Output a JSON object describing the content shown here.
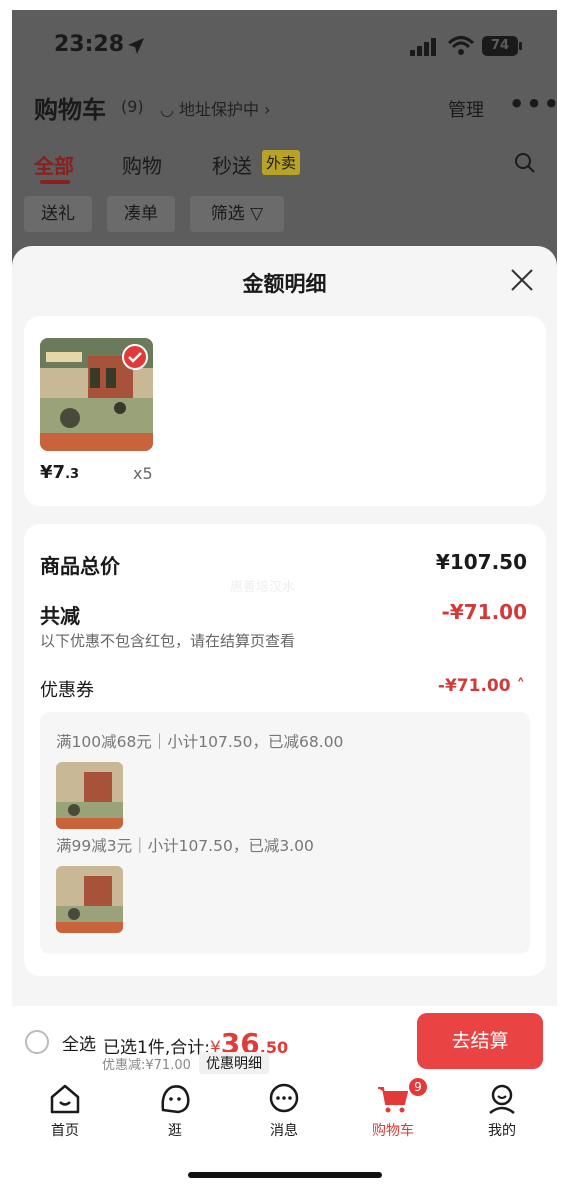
{
  "status_bar": {
    "time": "23:28",
    "battery": "74"
  },
  "header": {
    "title": "购物车",
    "count": "(9)",
    "address": "◡ 地址保护中 ›",
    "manage": "管理",
    "more": "•••"
  },
  "tabs": [
    {
      "label": "全部"
    },
    {
      "label": "购物"
    },
    {
      "label": "秒送"
    }
  ],
  "tab_badge": "外卖",
  "filters": [
    {
      "label": "送礼"
    },
    {
      "label": "凑单"
    },
    {
      "label": "筛选 ▽"
    }
  ],
  "sheet": {
    "title": "金额明细"
  },
  "product": {
    "price_symbol": "¥",
    "price_int": "7",
    "price_dec": ".3",
    "quantity": "x5"
  },
  "summary": {
    "total_label": "商品总价",
    "total_value": "¥107.50",
    "discount_label": "共减",
    "discount_value": "-¥71.00",
    "note": "以下优惠不包含红包，请在结算页查看",
    "coupon_label": "优惠券",
    "coupon_value": "-¥71.00 ˄"
  },
  "coupons": [
    {
      "text": "满100减68元｜小计107.50，已减68.00"
    },
    {
      "text": "满99减3元｜小计107.50，已减3.00"
    }
  ],
  "watermark": "惠善培汉水",
  "bottom": {
    "select_all": "全选",
    "selected_text": "已选1件,合计:",
    "total_symbol": "¥",
    "total_int": "36",
    "total_dec": ".50",
    "discount_text": "优惠减:¥71.00",
    "detail_link": "优惠明细",
    "checkout": "去结算"
  },
  "nav": [
    {
      "label": "首页",
      "icon": "home-icon"
    },
    {
      "label": "逛",
      "icon": "browse-icon"
    },
    {
      "label": "消息",
      "icon": "message-icon"
    },
    {
      "label": "购物车",
      "icon": "cart-icon"
    },
    {
      "label": "我的",
      "icon": "profile-icon"
    }
  ],
  "cart_badge": "9",
  "colors": {
    "accent": "#e23a3a",
    "overlay": "#5d5d5d",
    "sheet_bg": "#f5f5f5"
  }
}
